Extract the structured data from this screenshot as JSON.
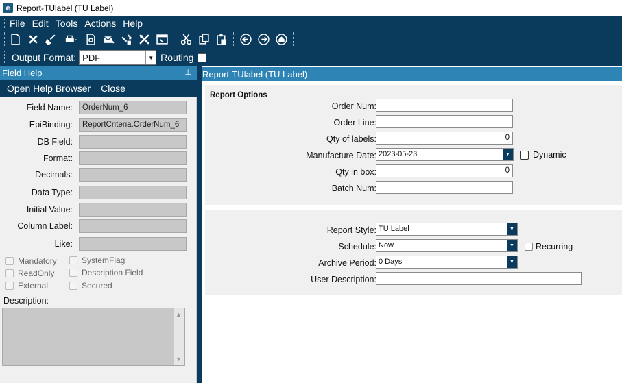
{
  "window": {
    "title": "Report-TUlabel (TU Label)",
    "logo_letter": "e"
  },
  "menu": [
    "File",
    "Edit",
    "Tools",
    "Actions",
    "Help"
  ],
  "toolbar_icons": [
    "new-icon",
    "delete-icon",
    "clear-icon",
    "print-icon",
    "print-preview-icon",
    "send-email-icon",
    "attach-icon",
    "settings-icon",
    "window-icon",
    "cut-icon",
    "copy-icon",
    "paste-icon",
    "back-icon",
    "forward-icon",
    "home-icon"
  ],
  "output": {
    "label": "Output Format:",
    "value": "PDF",
    "routing_label": "Routing"
  },
  "field_help": {
    "title": "Field Help",
    "open_help_browser": "Open Help Browser",
    "close": "Close",
    "rows": [
      {
        "label": "Field Name:",
        "value": "OrderNum_6"
      },
      {
        "label": "EpiBinding:",
        "value": "ReportCriteria.OrderNum_6"
      },
      {
        "label": "DB Field:",
        "value": ""
      },
      {
        "label": "Format:",
        "value": ""
      },
      {
        "label": "Decimals:",
        "value": ""
      },
      {
        "label": "Data Type:",
        "value": ""
      },
      {
        "label": "Initial Value:",
        "value": ""
      },
      {
        "label": "Column Label:",
        "value": ""
      },
      {
        "label": "Like:",
        "value": ""
      }
    ],
    "checks": {
      "mandatory": "Mandatory",
      "readonly": "ReadOnly",
      "external": "External",
      "systemflag": "SystemFlag",
      "description_field": "Description Field",
      "secured": "Secured"
    },
    "description_label": "Description:"
  },
  "report": {
    "title": "Report-TUlabel (TU Label)",
    "options_title": "Report Options",
    "order_num_label": "Order Num:",
    "order_num": "",
    "order_line_label": "Order Line:",
    "order_line": "",
    "qty_labels_label": "Qty of labels:",
    "qty_labels": "0",
    "mfg_date_label": "Manufacture Date:",
    "mfg_date": "2023-05-23",
    "dynamic_label": "Dynamic",
    "qty_box_label": "Qty in box:",
    "qty_box": "0",
    "batch_num_label": "Batch Num:",
    "batch_num": "",
    "report_style_label": "Report Style:",
    "report_style": "TU Label",
    "schedule_label": "Schedule:",
    "schedule": "Now",
    "recurring_label": "Recurring",
    "archive_label": "Archive Period:",
    "archive": "0 Days",
    "user_desc_label": "User Description:",
    "user_desc": ""
  }
}
